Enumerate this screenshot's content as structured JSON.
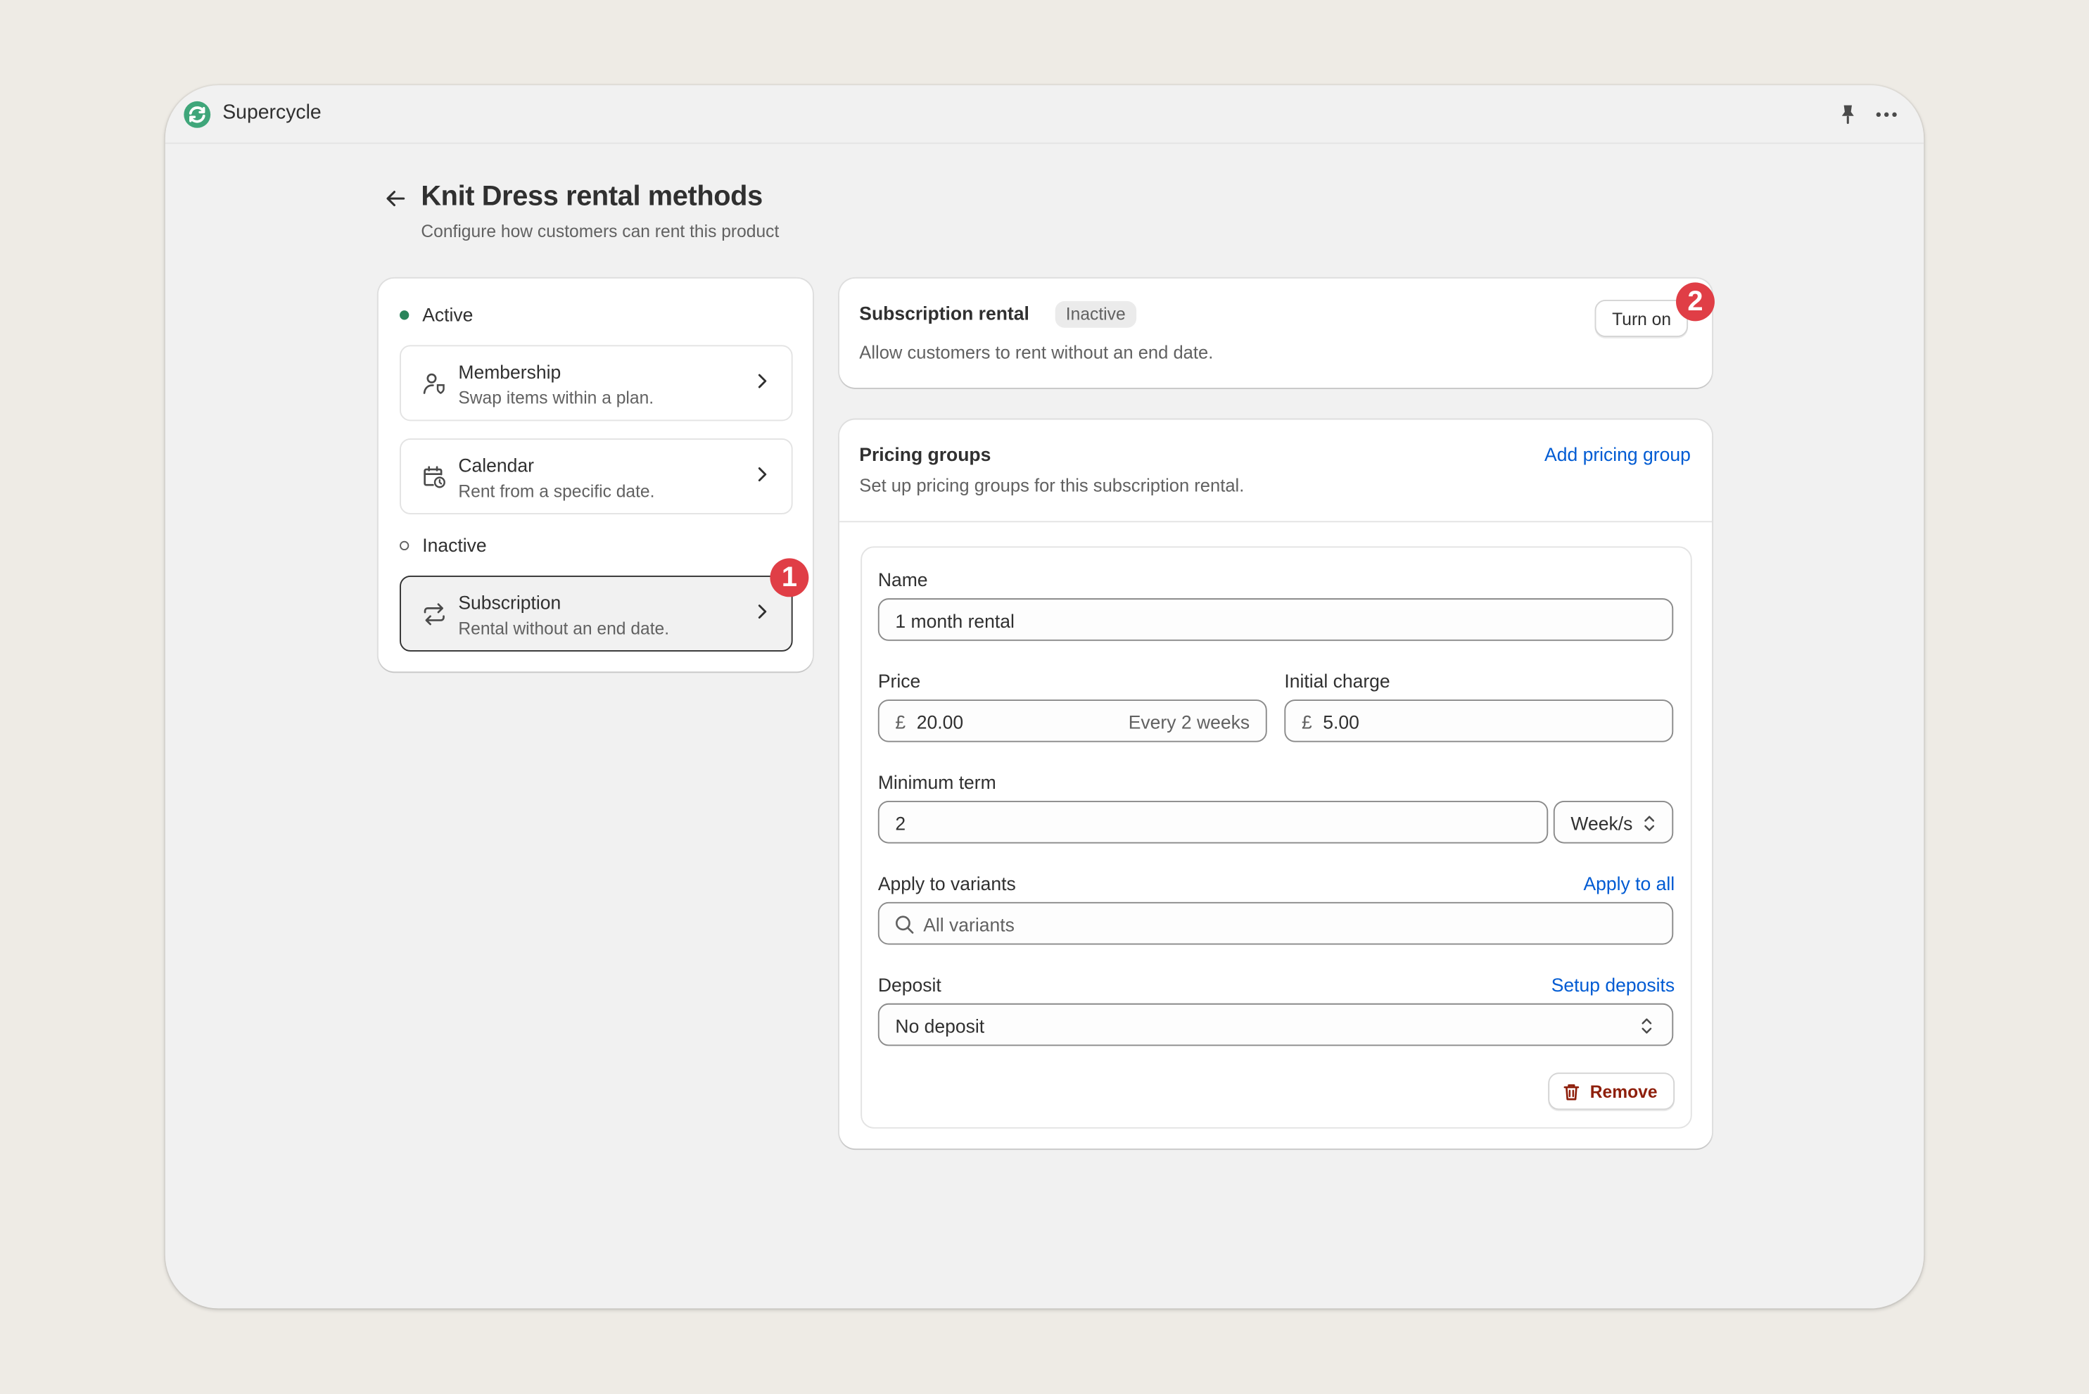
{
  "app": {
    "name": "Supercycle",
    "logo_icon": "supercycle-logo-icon",
    "pin_icon": "pin-icon",
    "more_icon": "more-horizontal-icon"
  },
  "page": {
    "title": "Knit Dress rental methods",
    "subtitle": "Configure how customers can rent this product"
  },
  "methods": {
    "active_label": "Active",
    "inactive_label": "Inactive",
    "membership": {
      "title": "Membership",
      "desc": "Swap items within a plan."
    },
    "calendar": {
      "title": "Calendar",
      "desc": "Rent from a specific date."
    },
    "subscription": {
      "title": "Subscription",
      "desc": "Rental without an end date."
    }
  },
  "annotations": {
    "one": "1",
    "two": "2"
  },
  "subscription_card": {
    "title": "Subscription rental",
    "status": "Inactive",
    "desc": "Allow customers to rent without an end date.",
    "turn_on_label": "Turn on"
  },
  "pricing": {
    "title": "Pricing groups",
    "desc": "Set up pricing groups for this subscription rental.",
    "add_label": "Add pricing group",
    "group": {
      "name_label": "Name",
      "name_value": "1 month rental",
      "price_label": "Price",
      "price_currency": "£",
      "price_value": "20.00",
      "price_interval": "Every 2 weeks",
      "initial_label": "Initial charge",
      "initial_currency": "£",
      "initial_value": "5.00",
      "min_term_label": "Minimum term",
      "min_term_value": "2",
      "min_term_unit": "Week/s",
      "variants_label": "Apply to variants",
      "apply_all_label": "Apply to all",
      "variants_placeholder": "All variants",
      "deposit_label": "Deposit",
      "setup_deposits_label": "Setup deposits",
      "deposit_value": "No deposit",
      "remove_label": "Remove"
    }
  },
  "colors": {
    "accent_link": "#005BD3",
    "active_dot": "#29845A",
    "annotation": "#E03E46",
    "danger": "#8E1F0B"
  }
}
